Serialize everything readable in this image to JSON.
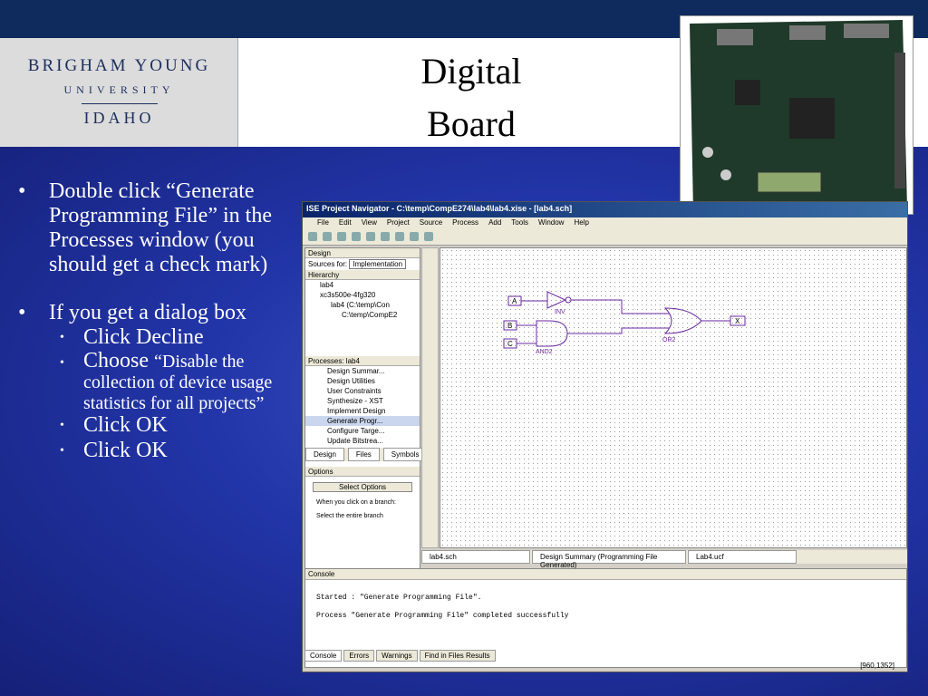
{
  "slide": {
    "title_line1": "Digital",
    "title_line2": "Board",
    "logo": {
      "line1": "BRIGHAM YOUNG",
      "line2": "UNIVERSITY",
      "line3": "IDAHO"
    },
    "bullets": [
      {
        "text": "Double click “Generate Programming File” in the Processes window (you should get a check mark)"
      },
      {
        "text": "If you get a dialog box"
      }
    ],
    "sub_bullets": [
      {
        "text": "Click Decline"
      },
      {
        "lead": "Choose",
        "rest": "“Disable the collection of device usage statistics for all projects”"
      },
      {
        "text": "Click OK"
      },
      {
        "text": "Click OK"
      }
    ]
  },
  "ise": {
    "window_title": "ISE Project Navigator - C:\\temp\\CompE274\\lab4\\lab4.xise - [lab4.sch]",
    "menu": [
      "File",
      "Edit",
      "View",
      "Project",
      "Source",
      "Process",
      "Add",
      "Tools",
      "Window",
      "Help"
    ],
    "design_pane": "Design",
    "sources_label": "Sources for:",
    "sources_value": "Implementation",
    "hierarchy": "Hierarchy",
    "tree": [
      "lab4",
      "xc3s500e-4fg320",
      "lab4 (C:\\temp\\Con",
      "C:\\temp\\CompE2"
    ],
    "processes_label": "Processes: lab4",
    "processes": [
      "Design Summar...",
      "Design Utilities",
      "User Constraints",
      "Synthesize - XST",
      "Implement Design",
      "Generate Progr...",
      "Configure Targe...",
      "Update Bitstrea..."
    ],
    "left_tabs": [
      "Design",
      "Files",
      "Symbols"
    ],
    "options": {
      "title": "Options",
      "button": "Select Options",
      "desc": "When you click on a branch:",
      "radio": "Select the entire branch"
    },
    "schematic": {
      "inputs": [
        "A",
        "B",
        "C"
      ],
      "output": "X",
      "gates": [
        "INV",
        "AND2",
        "OR2"
      ]
    },
    "doc_tabs": [
      "lab4.sch",
      "Design Summary (Programming File Generated)",
      "Lab4.ucf"
    ],
    "console": {
      "title": "Console",
      "line1": "Started : \"Generate Programming File\".",
      "line2": "Process \"Generate Programming File\" completed successfully"
    },
    "console_tabs": [
      "Console",
      "Errors",
      "Warnings",
      "Find in Files Results"
    ],
    "status": "[960,1352]"
  }
}
